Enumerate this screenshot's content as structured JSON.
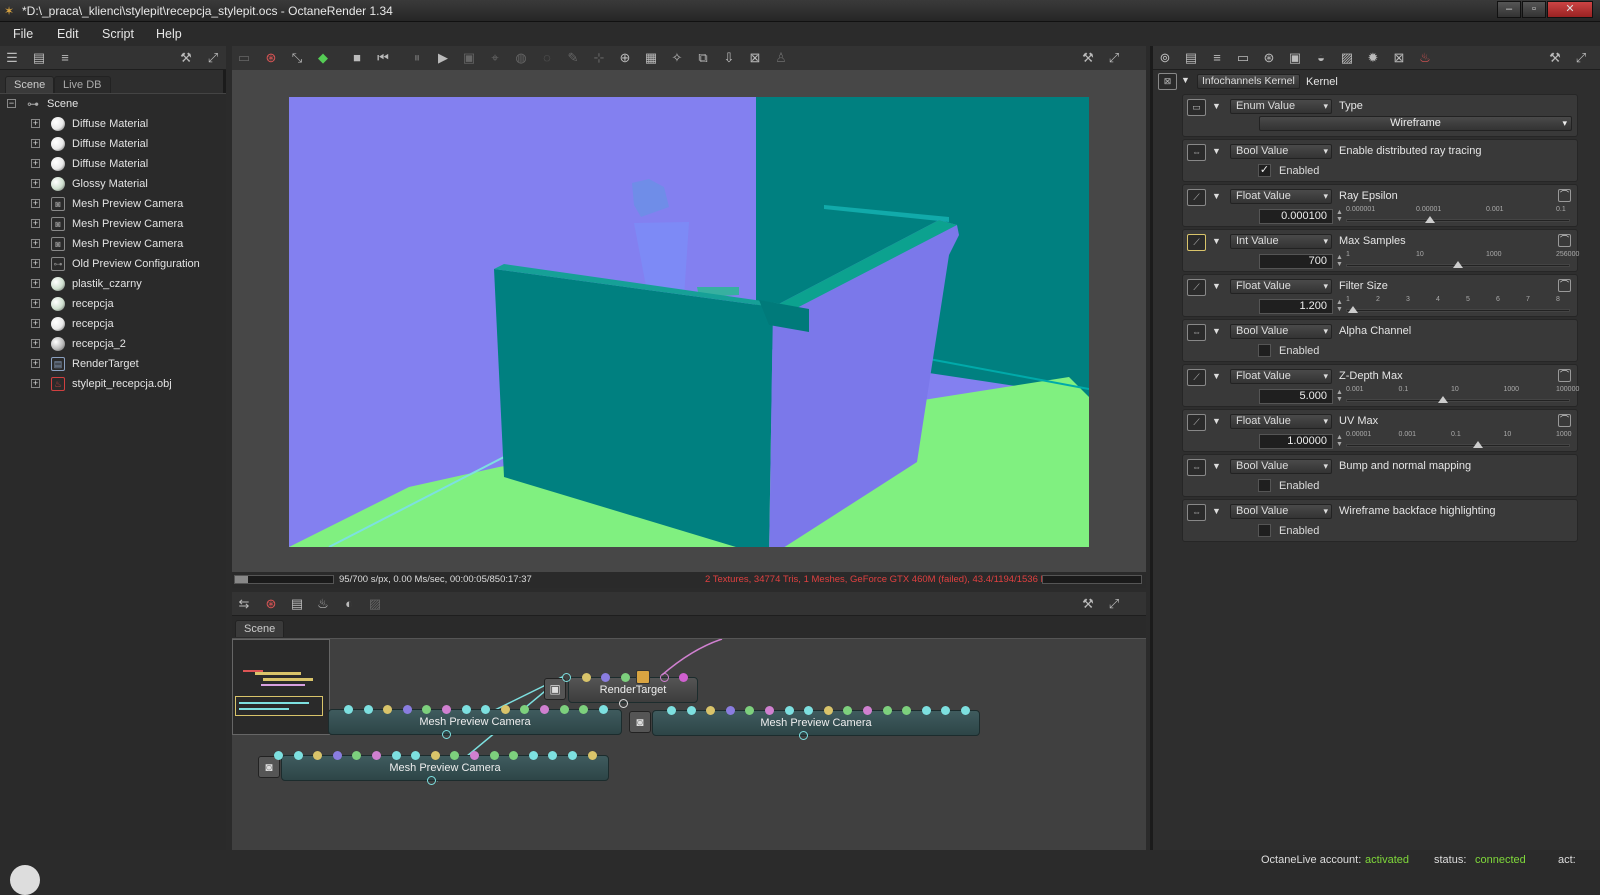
{
  "window": {
    "title": "*D:\\_praca\\_klienci\\stylepit\\recepcja_stylepit.ocs - OctaneRender 1.34",
    "minimize": "–",
    "maximize": "▫",
    "close": "✕"
  },
  "menu": [
    "File",
    "Edit",
    "Script",
    "Help"
  ],
  "scene_panel": {
    "tabs": [
      "Scene",
      "Live DB"
    ],
    "root": "Scene",
    "items": [
      {
        "label": "Diffuse Material",
        "icon": "diffuse-material-icon",
        "color": "#e8e8e8"
      },
      {
        "label": "Diffuse Material",
        "icon": "diffuse-material-icon",
        "color": "#e8e8e8"
      },
      {
        "label": "Diffuse Material",
        "icon": "diffuse-material-icon",
        "color": "#e8e8e8"
      },
      {
        "label": "Glossy Material",
        "icon": "glossy-material-icon",
        "color": "#cfe0cf"
      },
      {
        "label": "Mesh Preview Camera",
        "icon": "camera-icon",
        "color": "#888888"
      },
      {
        "label": "Mesh Preview Camera",
        "icon": "camera-icon",
        "color": "#888888"
      },
      {
        "label": "Mesh Preview Camera",
        "icon": "camera-icon",
        "color": "#888888"
      },
      {
        "label": "Old Preview Configuration",
        "icon": "config-icon",
        "color": "#888888"
      },
      {
        "label": "plastik_czarny",
        "icon": "glossy-material-icon",
        "color": "#cfe0cf"
      },
      {
        "label": "recepcja",
        "icon": "glossy-material-icon",
        "color": "#cfe0cf"
      },
      {
        "label": "recepcja",
        "icon": "diffuse-material-icon",
        "color": "#e8e8e8"
      },
      {
        "label": "recepcja_2",
        "icon": "mix-material-icon",
        "color": "#bbbbbb"
      },
      {
        "label": "RenderTarget",
        "icon": "render-target-icon",
        "color": "#8aa0c0"
      },
      {
        "label": "stylepit_recepcja.obj",
        "icon": "mesh-icon",
        "color": "#d04040"
      }
    ]
  },
  "render_status": {
    "left": "95/700 s/px, 0.00 Ms/sec, 00:00:05/850:17:37",
    "right": "2 Textures, 34774 Tris, 1 Meshes, GeForce GTX 460M (failed), 43.4/1194/1536 MB",
    "progress": 0.136,
    "right_color": "#e04040"
  },
  "graph": {
    "tab": "Scene",
    "render_target": "RenderTarget",
    "cameras": [
      "Mesh Preview Camera",
      "Mesh Preview Camera",
      "Mesh Preview Camera"
    ]
  },
  "kernel": {
    "dropdown": "Infochannels Kernel",
    "label": "Kernel",
    "params": [
      {
        "type": "Enum Value",
        "name": "Type",
        "kind": "enum",
        "value": "Wireframe"
      },
      {
        "type": "Bool Value",
        "name": "Enable distributed ray tracing",
        "kind": "bool",
        "checked": "✓",
        "label": "Enabled"
      },
      {
        "type": "Float Value",
        "name": "Ray Epsilon",
        "kind": "num",
        "value": "0.000100",
        "ticks": [
          "0.000001",
          "0.00001",
          "0.001",
          "0.1"
        ],
        "pos": 0.38
      },
      {
        "type": "Int Value",
        "name": "Max Samples",
        "kind": "num",
        "value": "700",
        "ticks": [
          "1",
          "10",
          "1000",
          "256000"
        ],
        "pos": 0.51
      },
      {
        "type": "Float Value",
        "name": "Filter Size",
        "kind": "num",
        "value": "1.200",
        "ticks": [
          "1",
          "2",
          "3",
          "4",
          "5",
          "6",
          "7",
          "8"
        ],
        "pos": 0.03
      },
      {
        "type": "Bool Value",
        "name": "Alpha Channel",
        "kind": "bool",
        "checked": "",
        "label": "Enabled"
      },
      {
        "type": "Float Value",
        "name": "Z-Depth Max",
        "kind": "num",
        "value": "5.000",
        "ticks": [
          "0.001",
          "0.1",
          "10",
          "1000",
          "100000"
        ],
        "pos": 0.44
      },
      {
        "type": "Float Value",
        "name": "UV Max",
        "kind": "num",
        "value": "1.00000",
        "ticks": [
          "0.00001",
          "0.001",
          "0.1",
          "10",
          "1000"
        ],
        "pos": 0.6
      },
      {
        "type": "Bool Value",
        "name": "Bump and normal mapping",
        "kind": "bool",
        "checked": "",
        "label": "Enabled"
      },
      {
        "type": "Bool Value",
        "name": "Wireframe backface highlighting",
        "kind": "bool",
        "checked": "",
        "label": "Enabled"
      }
    ]
  },
  "statusbar": {
    "account_label": "OctaneLive account:",
    "account_value": "activated",
    "status_label": "status:",
    "status_value": "connected",
    "act_label": "act:",
    "accent": "#7fd83a"
  }
}
